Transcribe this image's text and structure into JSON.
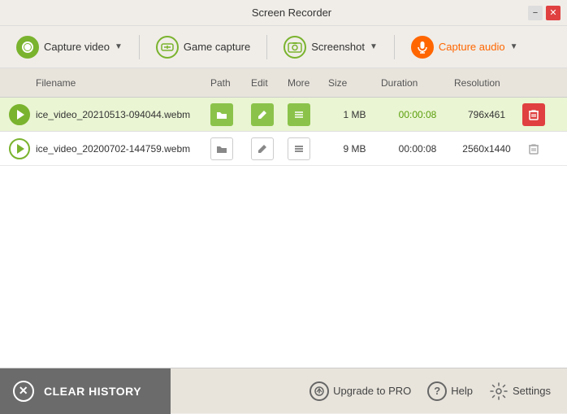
{
  "titlebar": {
    "title": "Screen Recorder",
    "minimize_label": "−",
    "close_label": "✕"
  },
  "toolbar": {
    "capture_video_label": "Capture video",
    "game_capture_label": "Game capture",
    "screenshot_label": "Screenshot",
    "capture_audio_label": "Capture audio"
  },
  "table": {
    "columns": [
      "Filename",
      "Path",
      "Edit",
      "More",
      "Size",
      "Duration",
      "Resolution",
      ""
    ],
    "rows": [
      {
        "filename": "ice_video_20210513-094044.webm",
        "size": "1 MB",
        "duration": "00:00:08",
        "resolution": "796x461",
        "highlighted": true
      },
      {
        "filename": "ice_video_20200702-144759.webm",
        "size": "9 MB",
        "duration": "00:00:08",
        "resolution": "2560x1440",
        "highlighted": false
      }
    ]
  },
  "bottom": {
    "clear_history_label": "CLEAR HISTORY",
    "upgrade_label": "Upgrade to PRO",
    "help_label": "Help",
    "settings_label": "Settings"
  }
}
